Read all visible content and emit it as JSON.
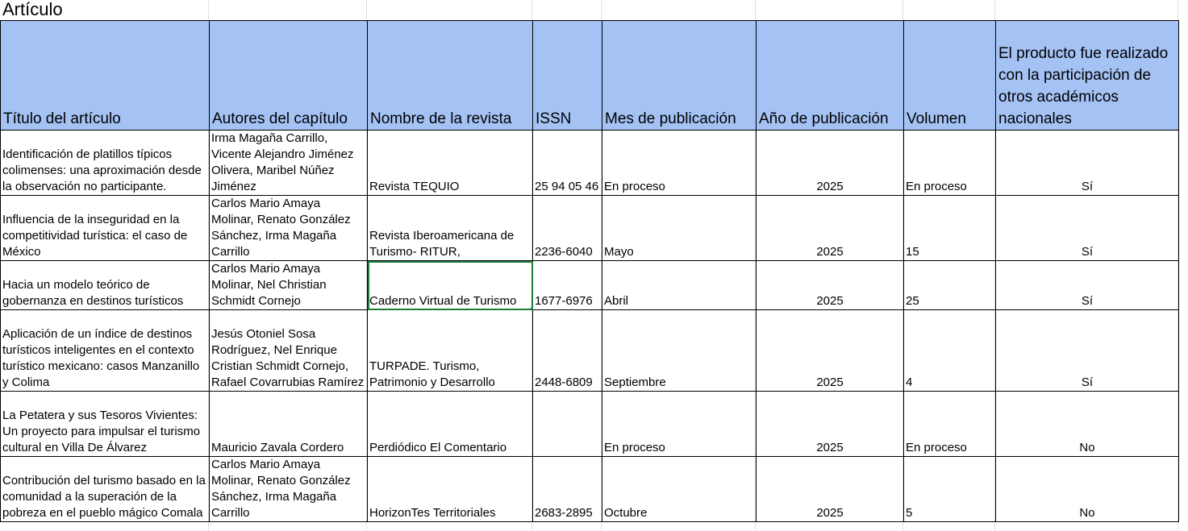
{
  "sheet_title": "Artículo",
  "headers": [
    "Título del artículo",
    "Autores del capítulo",
    "Nombre de la revista",
    "ISSN",
    "Mes de publicación",
    "Año de publicación",
    "Volumen",
    "El producto fue realizado con la participación de otros académicos nacionales"
  ],
  "rows": [
    {
      "titulo": "Identificación de platillos típicos colimenses: una aproximación desde la observación no participante.",
      "autores": "Irma Magaña Carrillo, Vicente Alejandro Jiménez Olivera, Maribel Núñez Jiménez",
      "revista": "Revista TEQUIO",
      "issn": "25 94 05 46",
      "mes": "En proceso",
      "anio": "2025",
      "volumen": "En proceso",
      "participacion": "Sí"
    },
    {
      "titulo": "Influencia de la inseguridad en la competitividad turística: el caso de México",
      "autores": "Carlos Mario Amaya Molinar, Renato González Sánchez, Irma Magaña Carrillo",
      "revista": "Revista Iberoamericana de Turismo- RITUR,",
      "issn": "2236-6040",
      "mes": "Mayo",
      "anio": "2025",
      "volumen": "15",
      "participacion": "Sí"
    },
    {
      "titulo": "Hacia un modelo teórico de gobernanza en destinos turísticos",
      "autores": "Carlos Mario Amaya Molinar, Nel Christian Schmidt Cornejo",
      "revista": "Caderno Virtual de Turismo",
      "issn": "1677-6976",
      "mes": "Abril",
      "anio": "2025",
      "volumen": "25",
      "participacion": "Sí"
    },
    {
      "titulo": "Aplicación de un índice de destinos turísticos inteligentes en el contexto turístico mexicano: casos Manzanillo y Colima",
      "autores": "Jesús Otoniel Sosa Rodríguez, Nel Enrique Cristian Schmidt Cornejo, Rafael Covarrubias Ramírez",
      "revista": "TURPADE. Turismo, Patrimonio y Desarrollo",
      "issn": "2448-6809",
      "mes": "Septiembre",
      "anio": "2025",
      "volumen": "4",
      "participacion": "Sí"
    },
    {
      "titulo": "La Petatera y sus Tesoros Vivientes: Un proyecto para impulsar el turismo cultural en Villa De Álvarez",
      "autores": "Mauricio Zavala Cordero",
      "revista": "Perdiódico El Comentario",
      "issn": "",
      "mes": "En proceso",
      "anio": "2025",
      "volumen": "En proceso",
      "participacion": "No"
    },
    {
      "titulo": "Contribución del turismo basado en la comunidad a la superación de la pobreza en el pueblo mágico Comala",
      "autores": "Carlos Mario Amaya Molinar, Renato González Sánchez, Irma Magaña Carrillo",
      "revista": "HorizonTes Territoriales",
      "issn": "2683-2895",
      "mes": "Octubre",
      "anio": "2025",
      "volumen": "5",
      "participacion": "No"
    }
  ]
}
